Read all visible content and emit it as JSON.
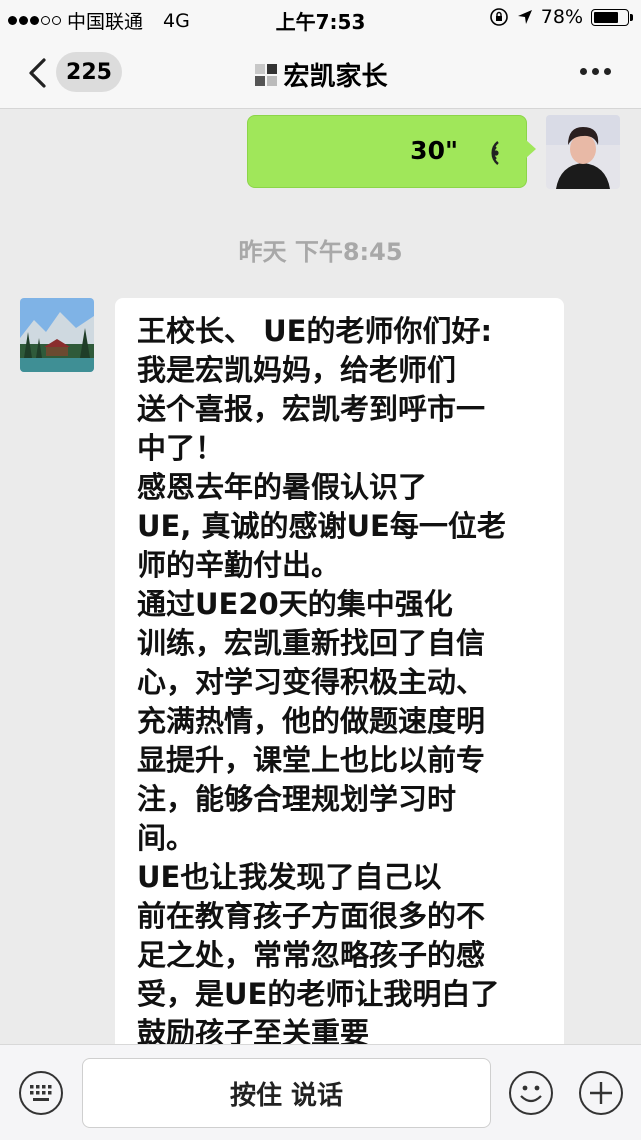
{
  "status_bar": {
    "carrier": "中国联通",
    "network": "4G",
    "time": "上午7:53",
    "battery": "78%",
    "battery_level": 0.78
  },
  "nav": {
    "back_count": "225",
    "title": "宏凯家长",
    "title_icon": "group-icon",
    "more_icon": "more-icon"
  },
  "messages": {
    "voice": {
      "duration": "30\"",
      "icon": "voice-wave-icon"
    },
    "timestamp": "昨天 下午8:45",
    "text_lines": [
      "王校长、 UE的老师你们好:",
      "   我是宏凯妈妈，给老师们",
      "送个喜报，宏凯考到呼市一",
      "中了！",
      "   感恩去年的暑假认识了",
      "UE, 真诚的感谢UE每一位老",
      "师的辛勤付出。",
      "   通过UE20天的集中强化",
      "训练，宏凯重新找回了自信",
      "心，对学习变得积极主动、",
      "充满热情，他的做题速度明",
      "显提升，课堂上也比以前专",
      "注，能够合理规划学习时",
      "间。",
      "    UE也让我发现了自己以",
      "前在教育孩子方面很多的不",
      "足之处，常常忽略孩子的感",
      "受，是UE的老师让我明白了",
      "鼓励孩子至关重要"
    ]
  },
  "input_bar": {
    "hold_to_talk": "按住 说话",
    "keyboard_icon": "keyboard-icon",
    "emoji_icon": "emoji-icon",
    "plus_icon": "plus-icon"
  },
  "colors": {
    "sent_bubble": "#a0e75a",
    "background": "#ebebeb",
    "timestamp": "#a8a8a8"
  }
}
